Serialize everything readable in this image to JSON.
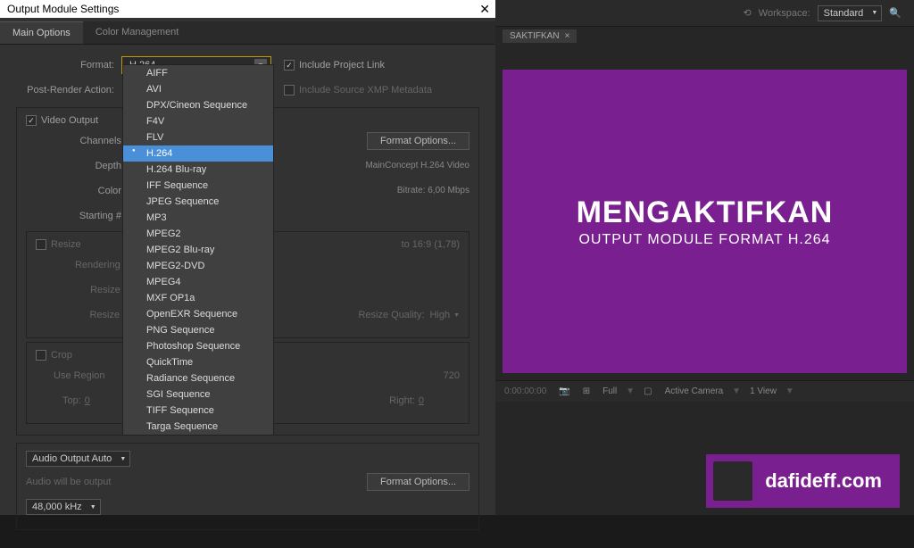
{
  "dialog": {
    "title": "Output Module Settings",
    "tabs": {
      "main": "Main Options",
      "color": "Color Management"
    },
    "labels": {
      "format": "Format:",
      "postRender": "Post-Render Action:",
      "channels": "Channels:",
      "depth": "Depth:",
      "color": "Color:",
      "startingNum": "Starting #:",
      "renderingAt": "Rendering at:",
      "resizeTo": "Resize to:",
      "resizePct": "Resize %:",
      "top": "Top:",
      "right": "Right:",
      "topVal": "0",
      "rightVal": "0",
      "audioNote": "Audio will be output"
    },
    "checkboxes": {
      "includeLink": "Include Project Link",
      "includeXmp": "Include Source XMP Metadata",
      "videoOutput": "Video Output",
      "resize": "Resize",
      "crop": "Crop",
      "useRegion": "Use Region"
    },
    "formatValue": "H.264",
    "formatOptions": [
      "AIFF",
      "AVI",
      "DPX/Cineon Sequence",
      "F4V",
      "FLV",
      "H.264",
      "H.264 Blu-ray",
      "IFF Sequence",
      "JPEG Sequence",
      "MP3",
      "MPEG2",
      "MPEG2 Blu-ray",
      "MPEG2-DVD",
      "MPEG4",
      "MXF OP1a",
      "OpenEXR Sequence",
      "PNG Sequence",
      "Photoshop Sequence",
      "QuickTime",
      "Radiance Sequence",
      "SGI Sequence",
      "TIFF Sequence",
      "Targa Sequence"
    ],
    "selectedFormatIndex": 5,
    "buttons": {
      "formatOptions": "Format Options..."
    },
    "codecInfo1": "MainConcept H.264 Video",
    "codecInfo2": "Bitrate: 6,00 Mbps",
    "stretchHint": "to 16:9 (1,78)",
    "resizeQualityLabel": "Resize Quality:",
    "resizeQualityVal": "High",
    "cropRes": "720",
    "audioOutput": "Audio Output Auto",
    "audioRate": "48,000 kHz"
  },
  "workspace": {
    "label": "Workspace:",
    "value": "Standard",
    "tabName": "SAKTIFKAN"
  },
  "preview": {
    "title": "MENGAKTIFKAN",
    "subtitle": "OUTPUT MODULE FORMAT H.264"
  },
  "timeline": {
    "time": "0:00:00:00",
    "full": "Full",
    "camera": "Active Camera",
    "view": "1 View"
  },
  "banner": {
    "text": "dafideff.com"
  },
  "watermark": "dafideff.com"
}
